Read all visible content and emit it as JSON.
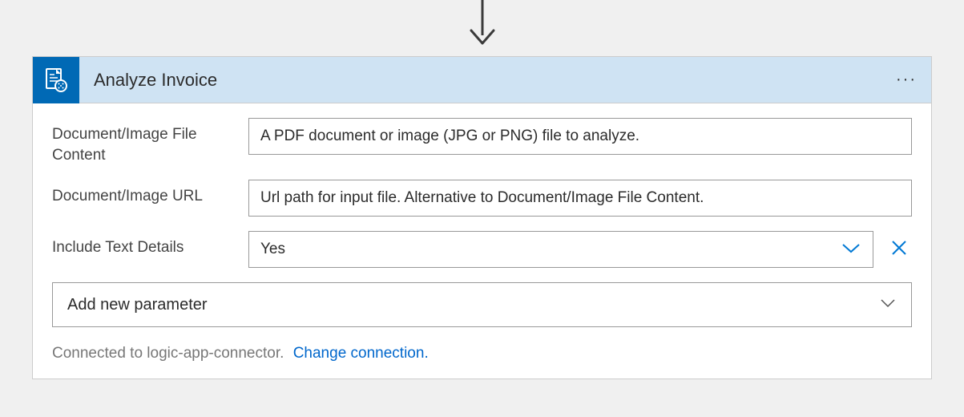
{
  "header": {
    "title": "Analyze Invoice"
  },
  "params": {
    "fileContent": {
      "label": "Document/Image File Content",
      "placeholder": "A PDF document or image (JPG or PNG) file to analyze."
    },
    "url": {
      "label": "Document/Image URL",
      "placeholder": "Url path for input file. Alternative to Document/Image File Content."
    },
    "includeTextDetails": {
      "label": "Include Text Details",
      "value": "Yes"
    }
  },
  "addParam": {
    "label": "Add new parameter"
  },
  "connection": {
    "status": "Connected to logic-app-connector.",
    "changeLabel": "Change connection."
  }
}
